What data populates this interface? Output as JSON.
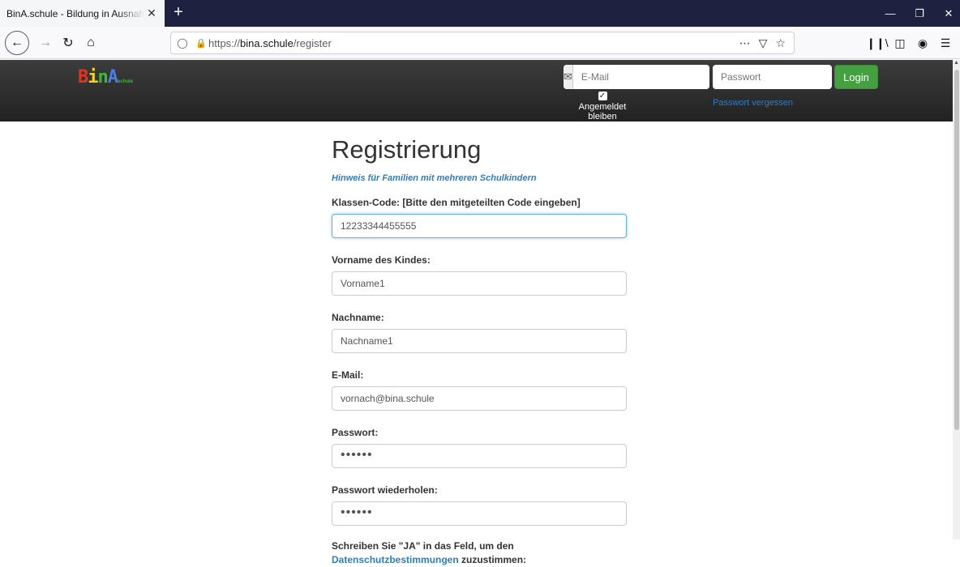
{
  "browser": {
    "tab_title": "BinA.schule - Bildung in Ausnahmesituationen",
    "tab_close": "✕",
    "new_tab": "+",
    "url_prefix": "https://",
    "url_domain": "bina.schule",
    "url_path": "/register",
    "icons": [
      "back-icon",
      "forward-icon",
      "reload-icon",
      "home-icon",
      "shield-icon",
      "lock-icon",
      "more-icon",
      "pocket-icon",
      "star-icon",
      "library-icon",
      "sidebar-icon",
      "account-icon",
      "menu-icon"
    ]
  },
  "header": {
    "logo_letters": [
      "B",
      "i",
      "n",
      "A"
    ],
    "logo_suffix": "schule",
    "email_placeholder": "E-Mail",
    "password_placeholder": "Passwort",
    "login_label": "Login",
    "remember_label": "Angemeldet bleiben",
    "remember_checked": true,
    "forgot_label": "Passwort vergessen"
  },
  "form": {
    "title": "Registrierung",
    "hint": "Hinweis für Familien mit mehreren Schulkindern",
    "fields": [
      {
        "label": "Klassen-Code: [Bitte den mitgeteilten Code eingeben]",
        "value": "12233344455555"
      },
      {
        "label": "Vorname des Kindes:",
        "value": "Vorname1"
      },
      {
        "label": "Nachname:",
        "value": "Nachname1"
      },
      {
        "label": "E-Mail:",
        "value": "vornach@bina.schule"
      },
      {
        "label": "Passwort:",
        "value": "••••••"
      },
      {
        "label": "Passwort wiederholen:",
        "value": "••••••"
      }
    ],
    "consent_before": "Schreiben Sie \"JA\" in das Feld, um den",
    "consent_link": "Datenschutzbestimmungen",
    "consent_after": " zuzustimmen:"
  },
  "colors": {
    "link": "#2f7dc2",
    "login_green": "#45a042",
    "tabbar": "#1f2140",
    "header": "#2b2b2b"
  }
}
